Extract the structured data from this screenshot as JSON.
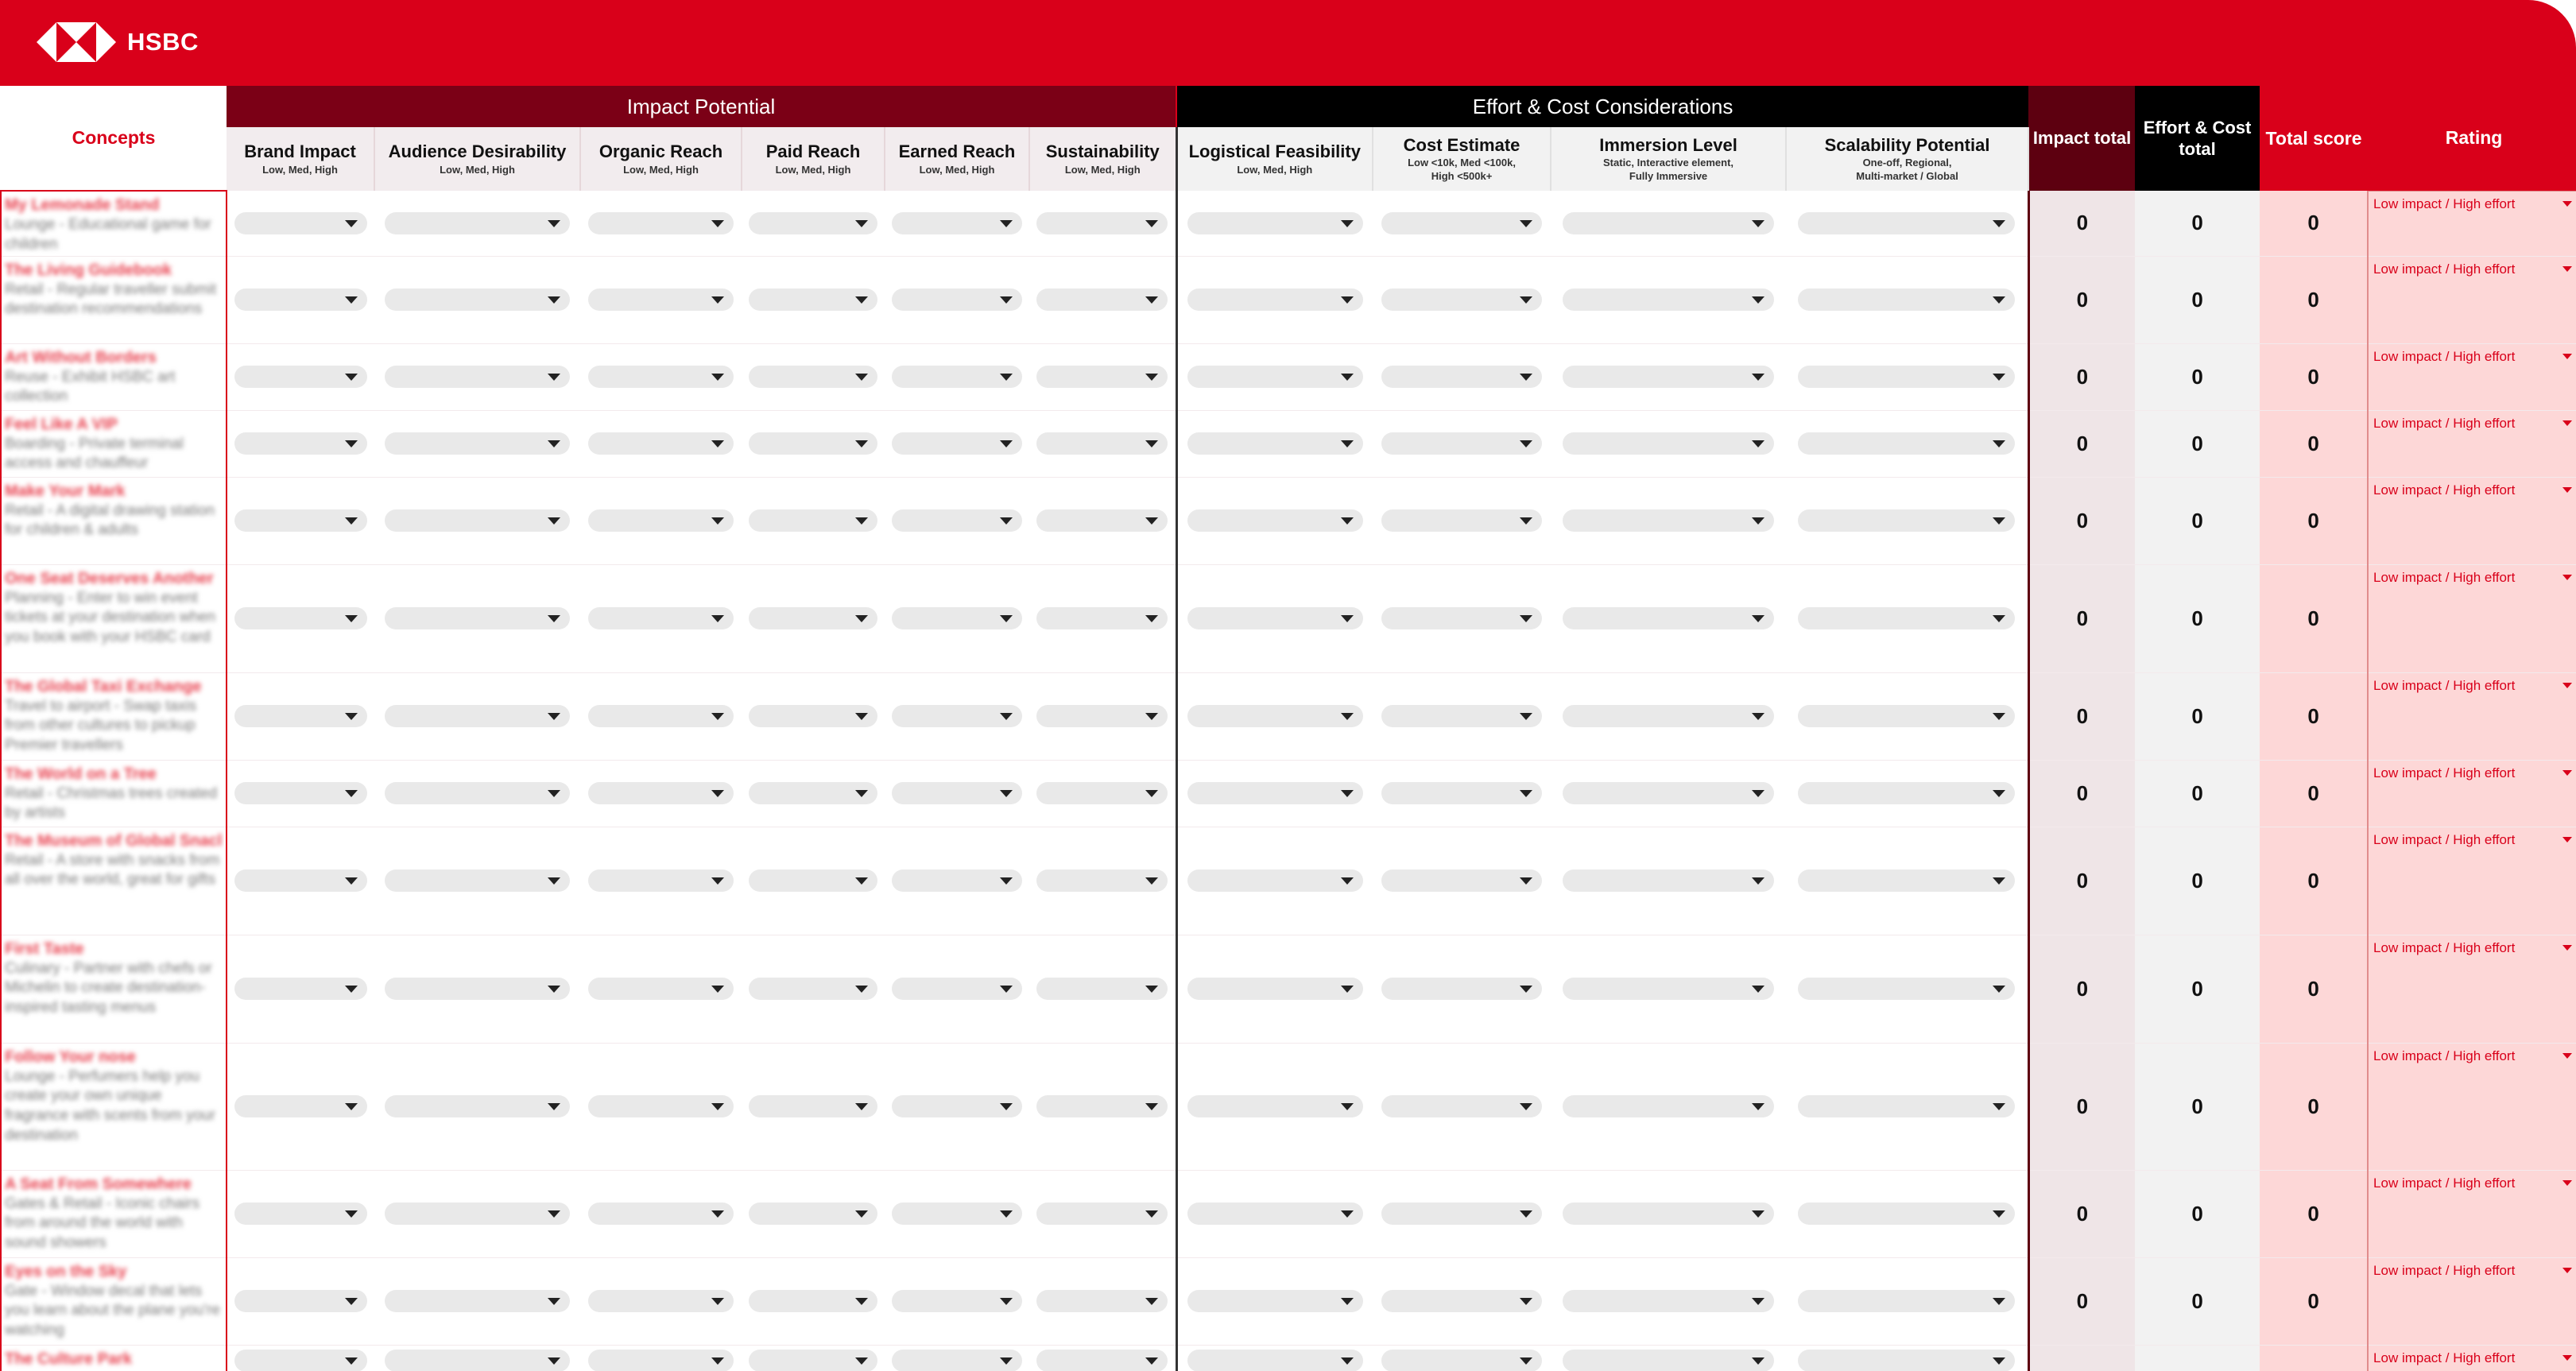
{
  "brand": {
    "name": "HSBC",
    "logo_icon": "hsbc-hexagon-logo-icon",
    "accent": "#d9001a",
    "dark_red": "#7b0016"
  },
  "groups": {
    "impact": "Impact Potential",
    "effort": "Effort & Cost Considerations"
  },
  "headers": {
    "concepts": "Concepts",
    "impact_total": "Impact total",
    "effort_total": "Effort & Cost total",
    "total_score": "Total score",
    "rating": "Rating"
  },
  "impact_columns": [
    {
      "title": "Brand Impact",
      "sub": "Low, Med, High"
    },
    {
      "title": "Audience Desirability",
      "sub": "Low, Med, High"
    },
    {
      "title": "Organic Reach",
      "sub": "Low, Med, High"
    },
    {
      "title": "Paid Reach",
      "sub": "Low, Med, High"
    },
    {
      "title": "Earned Reach",
      "sub": "Low, Med, High"
    },
    {
      "title": "Sustainability",
      "sub": "Low, Med, High"
    }
  ],
  "effort_columns": [
    {
      "title": "Logistical Feasibility",
      "sub": "Low, Med, High"
    },
    {
      "title": "Cost Estimate",
      "sub": "Low <10k, Med <100k,",
      "sub2": "High <500k+"
    },
    {
      "title": "Immersion Level",
      "sub": "Static, Interactive element,",
      "sub2": "Fully Immersive"
    },
    {
      "title": "Scalability Potential",
      "sub": "One-off, Regional,",
      "sub2": "Multi-market / Global"
    }
  ],
  "rows": [
    {
      "title": "My Lemonade Stand",
      "desc": "Lounge - Educational game for children",
      "impact_total": "0",
      "effort_total": "0",
      "total_score": "0",
      "rating": "Low impact / High effort"
    },
    {
      "title": "The Living Guidebook",
      "desc": "Retail - Regular traveller submit destination recommendations",
      "impact_total": "0",
      "effort_total": "0",
      "total_score": "0",
      "rating": "Low impact / High effort"
    },
    {
      "title": "Art Without Borders",
      "desc": "Reuse - Exhibit HSBC art collection",
      "impact_total": "0",
      "effort_total": "0",
      "total_score": "0",
      "rating": "Low impact / High effort"
    },
    {
      "title": "Feel Like A VIP",
      "desc": "Boarding - Private terminal access and chauffeur",
      "impact_total": "0",
      "effort_total": "0",
      "total_score": "0",
      "rating": "Low impact / High effort"
    },
    {
      "title": "Make Your Mark",
      "desc": "Retail - A digital drawing station for children & adults",
      "impact_total": "0",
      "effort_total": "0",
      "total_score": "0",
      "rating": "Low impact / High effort"
    },
    {
      "title": "One Seat Deserves Another",
      "desc": "Planning - Enter to win event tickets at your destination when you book with your HSBC card",
      "impact_total": "0",
      "effort_total": "0",
      "total_score": "0",
      "rating": "Low impact / High effort"
    },
    {
      "title": "The Global Taxi Exchange",
      "desc": "Travel to airport - Swap taxis from other cultures to pickup Premier travellers",
      "impact_total": "0",
      "effort_total": "0",
      "total_score": "0",
      "rating": "Low impact / High effort"
    },
    {
      "title": "The World on a Tree",
      "desc": "Retail - Christmas trees created by artists",
      "impact_total": "0",
      "effort_total": "0",
      "total_score": "0",
      "rating": "Low impact / High effort"
    },
    {
      "title": "The Museum of Global Snacks",
      "desc": "Retail - A store with snacks from all over the world, great for gifts",
      "impact_total": "0",
      "effort_total": "0",
      "total_score": "0",
      "rating": "Low impact / High effort"
    },
    {
      "title": "First Taste",
      "desc": "Culinary - Partner with chefs or Michelin to create destination-inspired tasting menus",
      "impact_total": "0",
      "effort_total": "0",
      "total_score": "0",
      "rating": "Low impact / High effort"
    },
    {
      "title": "Follow Your nose",
      "desc": "Lounge - Perfumers help you create your own unique fragrance with scents from your destination",
      "impact_total": "0",
      "effort_total": "0",
      "total_score": "0",
      "rating": "Low impact / High effort"
    },
    {
      "title": "A Seat From Somewhere",
      "desc": "Gates & Retail - Iconic chairs from around the world with sound showers",
      "impact_total": "0",
      "effort_total": "0",
      "total_score": "0",
      "rating": "Low impact / High effort"
    },
    {
      "title": "Eyes on the Sky",
      "desc": "Gate - Window decal that lets you learn about the plane you're watching",
      "impact_total": "0",
      "effort_total": "0",
      "total_score": "0",
      "rating": "Low impact / High effort"
    },
    {
      "title": "The Culture Park",
      "desc": "",
      "impact_total": "",
      "effort_total": "",
      "total_score": "",
      "rating": "Low impact / High effort"
    }
  ]
}
